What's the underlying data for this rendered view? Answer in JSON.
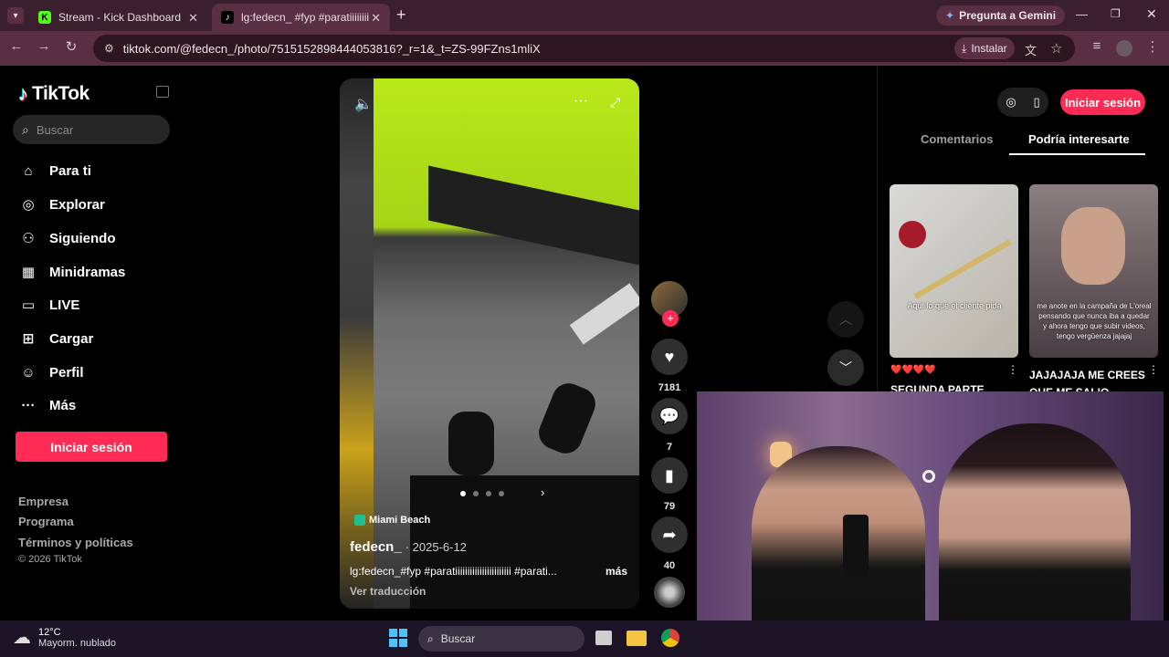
{
  "browser": {
    "tabs": [
      {
        "title": "Stream - Kick Dashboard",
        "favicon": "kick-icon",
        "active": false
      },
      {
        "title": "lg:fedecn_ #fyp #paratiiiiiiiiiiiii",
        "favicon": "tiktok-icon",
        "active": true
      }
    ],
    "gemini_label": "Pregunta a Gemini",
    "url": "tiktok.com/@fedecn_/photo/7515152898444053816?_r=1&_t=ZS-99FZns1mliX",
    "install_label": "Instalar"
  },
  "sidebar": {
    "logo_text": "TikTok",
    "search_placeholder": "Buscar",
    "items": [
      {
        "label": "Para ti",
        "icon": "home-icon"
      },
      {
        "label": "Explorar",
        "icon": "compass-icon"
      },
      {
        "label": "Siguiendo",
        "icon": "following-icon"
      },
      {
        "label": "Minidramas",
        "icon": "film-icon"
      },
      {
        "label": "LIVE",
        "icon": "live-icon"
      },
      {
        "label": "Cargar",
        "icon": "upload-icon"
      },
      {
        "label": "Perfil",
        "icon": "profile-icon"
      },
      {
        "label": "Más",
        "icon": "more-icon"
      }
    ],
    "login_label": "Iniciar sesión",
    "footer": [
      "Empresa",
      "Programa",
      "Términos y políticas"
    ],
    "copyright": "© 2026 TikTok"
  },
  "post": {
    "location": "Miami Beach",
    "username": "fedecn_",
    "date": "· 2025-6-12",
    "caption": "lg:fedecn_#fyp #paratiiiiiiiiiiiiiiiiiiiiiii #parati...",
    "more": "más",
    "translate": "Ver traducción",
    "likes": "7181",
    "comments": "7",
    "saves": "79",
    "shares": "40"
  },
  "right_panel": {
    "login_label": "Iniciar sesión",
    "tabs": [
      "Comentarios",
      "Podría interesarte"
    ],
    "active_tab": 1,
    "videos": [
      {
        "overlay_text": "Aquí lo que el cliente pida",
        "title": "SEGUNDA PARTE",
        "hearts": "❤️❤️❤️❤️"
      },
      {
        "overlay_text": "me anote en la campaña de L'oreal pensando que nunca iba a quedar y ahora tengo que subir videos, tengo vergüenza jajajaj",
        "title": "JAJAJAJA ME CREES QUE ME SALIO"
      }
    ]
  },
  "taskbar": {
    "temp": "12°C",
    "weather": "Mayorm. nublado",
    "search_placeholder": "Buscar"
  },
  "colors": {
    "tiktok_red": "#fe2c55",
    "tab_bg": "#3a1f2c",
    "toolbar_bg": "#5a2f42"
  }
}
